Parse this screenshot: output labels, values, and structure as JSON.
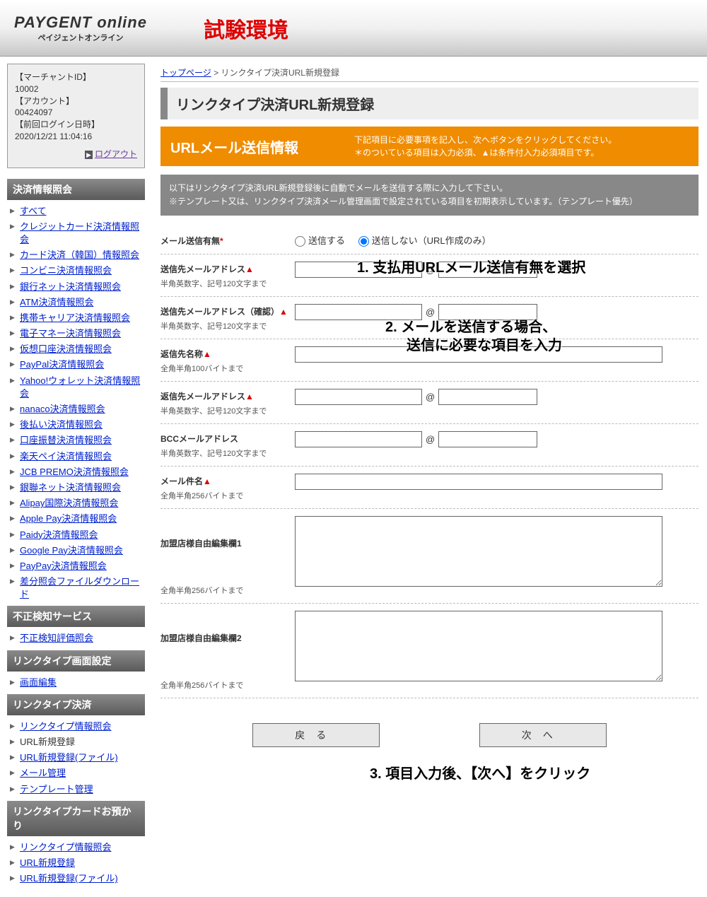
{
  "logo": {
    "main": "PAYGENT online",
    "sub": "ペイジェントオンライン"
  },
  "env": "試験環境",
  "account": {
    "merchant_label": "【マーチャントID】",
    "merchant_id": "10002",
    "account_label": "【アカウント】",
    "account_id": "00424097",
    "last_login_label": "【前回ログイン日時】",
    "last_login": "2020/12/21 11:04:16",
    "logout": "ログアウト"
  },
  "side": {
    "h1": "決済情報照会",
    "g1": [
      "すべて",
      "クレジットカード決済情報照会",
      "カード決済（韓国）情報照会",
      "コンビニ決済情報照会",
      "銀行ネット決済情報照会",
      "ATM決済情報照会",
      "携帯キャリア決済情報照会",
      "電子マネー決済情報照会",
      "仮想口座決済情報照会",
      "PayPal決済情報照会",
      "Yahoo!ウォレット決済情報照会",
      "nanaco決済情報照会",
      "後払い決済情報照会",
      "口座振替決済情報照会",
      "楽天ペイ決済情報照会",
      "JCB PREMO決済情報照会",
      "銀聯ネット決済情報照会",
      "Alipay国際決済情報照会",
      "Apple Pay決済情報照会",
      "Paidy決済情報照会",
      "Google Pay決済情報照会",
      "PayPay決済情報照会",
      "差分照会ファイルダウンロード"
    ],
    "h2": "不正検知サービス",
    "g2": [
      "不正検知評価照会"
    ],
    "h3": "リンクタイプ画面設定",
    "g3": [
      "画面編集"
    ],
    "h4": "リンクタイプ決済",
    "g4": [
      "リンクタイプ情報照会",
      "URL新規登録",
      "URL新規登録(ファイル)",
      "メール管理",
      "テンプレート管理"
    ],
    "g4_plain_index": 1,
    "h5": "リンクタイプカードお預かり",
    "g5": [
      "リンクタイプ情報照会",
      "URL新規登録",
      "URL新規登録(ファイル)"
    ]
  },
  "crumb": {
    "home": "トップページ",
    "sep": " > ",
    "cur": "リンクタイプ決済URL新規登録"
  },
  "ptitle": "リンクタイプ決済URL新規登録",
  "obar": {
    "title": "URLメール送信情報",
    "line1": "下記項目に必要事項を記入し、次へボタンをクリックしてください。",
    "line2": "＊のついている項目は入力必須、▲は条件付入力必須項目です。"
  },
  "gnote": {
    "line1": "以下はリンクタイプ決済URL新規登録後に自動でメールを送信する際に入力して下さい。",
    "line2": "※テンプレート又は、リンクタイプ決済メール管理画面で設定されている項目を初期表示しています。（テンプレート優先）"
  },
  "form": {
    "mail_send": {
      "label": "メール送信有無",
      "req": "*",
      "opt1": "送信する",
      "opt2": "送信しない（URL作成のみ）"
    },
    "dest": {
      "label": "送信先メールアドレス",
      "tri": "▲",
      "hint": "半角英数字、記号120文字まで"
    },
    "dest_c": {
      "label": "送信先メールアドレス（確認）",
      "tri": "▲",
      "hint": "半角英数字、記号120文字まで"
    },
    "reply_name": {
      "label": "返信先名称",
      "tri": "▲",
      "hint": "全角半角100バイトまで"
    },
    "reply_addr": {
      "label": "返信先メールアドレス",
      "tri": "▲",
      "hint": "半角英数字、記号120文字まで"
    },
    "bcc": {
      "label": "BCCメールアドレス",
      "hint": "半角英数字、記号120文字まで"
    },
    "subject": {
      "label": "メール件名",
      "tri": "▲",
      "hint": "全角半角256バイトまで"
    },
    "memo1": {
      "label": "加盟店様自由編集欄1",
      "hint": "全角半角256バイトまで"
    },
    "memo2": {
      "label": "加盟店様自由編集欄2",
      "hint": "全角半角256バイトまで"
    },
    "at": "@"
  },
  "btns": {
    "back": "戻る",
    "next": "次へ"
  },
  "ann": {
    "a1": "1. 支払用URLメール送信有無を選択",
    "a2a": "2. メールを送信する場合、",
    "a2b": "送信に必要な項目を入力",
    "a3": "3. 項目入力後、【次へ】をクリック"
  }
}
